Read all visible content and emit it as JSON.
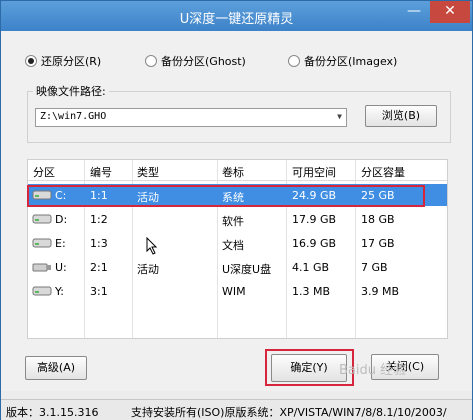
{
  "window": {
    "title": "U深度一键还原精灵",
    "minimize_glyph": "—",
    "close_glyph": "✕"
  },
  "radios": [
    {
      "label": "还原分区(R)",
      "checked": true
    },
    {
      "label": "备份分区(Ghost)",
      "checked": false
    },
    {
      "label": "备份分区(Imagex)",
      "checked": false
    }
  ],
  "image_path": {
    "label": "映像文件路径:",
    "value": "Z:\\win7.GHO",
    "browse_label": "浏览(B)"
  },
  "table": {
    "headers": [
      "分区",
      "编号",
      "类型",
      "卷标",
      "可用空间",
      "分区容量"
    ],
    "rows": [
      {
        "drive": "C:",
        "num": "1:1",
        "type": "活动",
        "label": "系统",
        "free": "24.9 GB",
        "size": "25 GB",
        "selected": true,
        "icon": "hard-disk-icon"
      },
      {
        "drive": "D:",
        "num": "1:2",
        "type": "",
        "label": "软件",
        "free": "17.9 GB",
        "size": "18 GB",
        "selected": false,
        "icon": "hard-disk-icon"
      },
      {
        "drive": "E:",
        "num": "1:3",
        "type": "",
        "label": "文档",
        "free": "16.9 GB",
        "size": "17 GB",
        "selected": false,
        "icon": "hard-disk-icon"
      },
      {
        "drive": "U:",
        "num": "2:1",
        "type": "活动",
        "label": "U深度U盘",
        "free": "4.1 GB",
        "size": "7 GB",
        "selected": false,
        "icon": "usb-disk-icon"
      },
      {
        "drive": "Y:",
        "num": "3:1",
        "type": "",
        "label": "WIM",
        "free": "1.3 MB",
        "size": "3.9 MB",
        "selected": false,
        "icon": "hard-disk-icon"
      }
    ]
  },
  "buttons": {
    "advanced": "高级(A)",
    "ok": "确定(Y)",
    "close": "关闭(C)"
  },
  "status": {
    "version": "版本：3.1.15.316",
    "support": "支持安装所有(ISO)原版系统：XP/VISTA/WIN7/8/8.1/10/2003/"
  },
  "watermark": "Baidu 经验",
  "colors": {
    "title_bar": "#4a8fd4",
    "selection": "#3f8ee4",
    "highlight_frame": "#d6263c"
  }
}
